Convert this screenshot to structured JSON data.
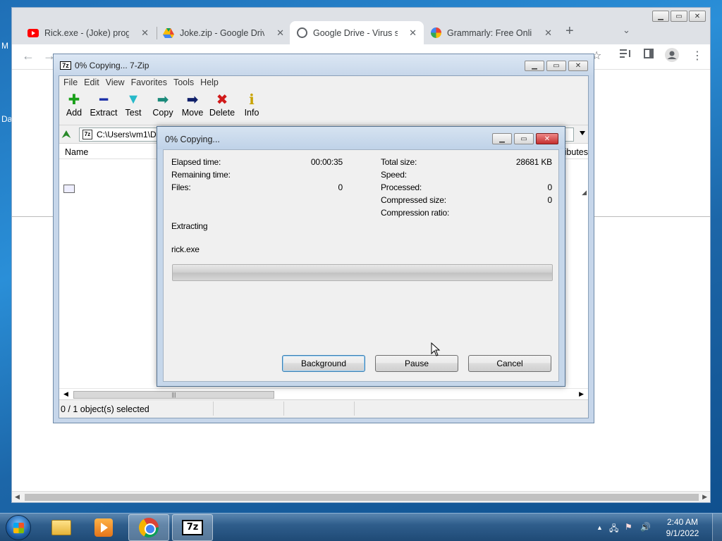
{
  "desktop": {
    "left_labels": [
      "M",
      "Da"
    ]
  },
  "browser": {
    "tabs": [
      {
        "title": "Rick.exe - (Joke) progra",
        "icon": "youtube-icon",
        "active": false
      },
      {
        "title": "Joke.zip - Google Drive",
        "icon": "google-drive-icon",
        "active": false
      },
      {
        "title": "Google Drive - Virus sca",
        "icon": "globe-icon",
        "active": true
      },
      {
        "title": "Grammarly: Free Online",
        "icon": "grammarly-icon",
        "active": false
      }
    ],
    "tab_close_glyph": "✕",
    "new_tab_glyph": "+",
    "tab_search_glyph": "⌄",
    "back_glyph": "←",
    "forward_glyph": "→",
    "bookmark_glyph": "☆",
    "menu_glyph": "⋮",
    "window_controls": {
      "minimize": "▁",
      "maximize": "▭",
      "close": "✕"
    }
  },
  "sevenzip": {
    "title": "0% Copying... 7-Zip",
    "menu": [
      "File",
      "Edit",
      "View",
      "Favorites",
      "Tools",
      "Help"
    ],
    "toolbar": [
      {
        "label": "Add",
        "glyph": "✚",
        "color": "#1aa01a"
      },
      {
        "label": "Extract",
        "glyph": "━",
        "color": "#1a2fa8"
      },
      {
        "label": "Test",
        "glyph": "▼",
        "color": "#27b9c9"
      },
      {
        "label": "Copy",
        "glyph": "➡",
        "color": "#1a8a7a"
      },
      {
        "label": "Move",
        "glyph": "➡",
        "color": "#10206a"
      },
      {
        "label": "Delete",
        "glyph": "✖",
        "color": "#d11a1a"
      },
      {
        "label": "Info",
        "glyph": "ℹ",
        "color": "#c9a300"
      }
    ],
    "address": "C:\\Users\\vm1\\D",
    "columns": {
      "name": "Name",
      "attributes": "Attributes"
    },
    "status": "0 / 1 object(s) selected",
    "scroll_thumb_glyph": "|||"
  },
  "dialog": {
    "title": "0% Copying...",
    "left": [
      {
        "label": "Elapsed time:",
        "value": "00:00:35"
      },
      {
        "label": "Remaining time:",
        "value": ""
      },
      {
        "label": "Files:",
        "value": "0"
      }
    ],
    "right": [
      {
        "label": "Total size:",
        "value": "28681 KB"
      },
      {
        "label": "Speed:",
        "value": ""
      },
      {
        "label": "Processed:",
        "value": "0"
      },
      {
        "label": "Compressed size:",
        "value": "0"
      },
      {
        "label": "Compression ratio:",
        "value": ""
      }
    ],
    "operation": "Extracting",
    "current_file": "rick.exe",
    "progress_fraction": 0,
    "buttons": {
      "background": "Background",
      "pause": "Pause",
      "cancel": "Cancel"
    }
  },
  "taskbar": {
    "apps": [
      {
        "name": "Windows Explorer",
        "icon": "folder-icon",
        "active": false
      },
      {
        "name": "Windows Media Player",
        "icon": "media-player-icon",
        "active": false
      },
      {
        "name": "Google Chrome",
        "icon": "chrome-icon",
        "active": true
      },
      {
        "name": "7-Zip",
        "icon": "7zip-icon",
        "active": true
      }
    ],
    "seven_zip_glyph": "7z",
    "clock_time": "2:40 AM",
    "clock_date": "9/1/2022",
    "tray_glyphs": {
      "expand": "▲",
      "network": "🖧",
      "flag": "⚑",
      "volume": "🔊"
    }
  }
}
